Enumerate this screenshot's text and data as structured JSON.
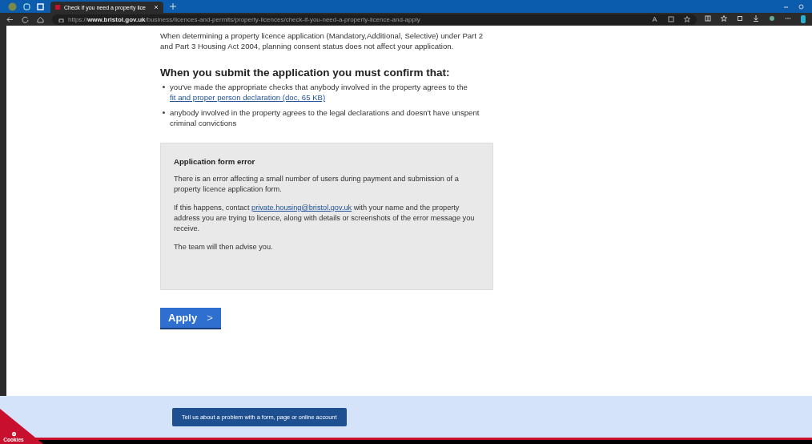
{
  "browser": {
    "tab": {
      "title": "Check if you need a property lice",
      "selected": true
    },
    "url": {
      "scheme": "https://",
      "domain": "www.bristol.gov.uk",
      "path": "/business/licences-and-permits/property-licences/check-if-you-need-a-property-licence-and-apply"
    }
  },
  "intro": "When determining a property licence application (Mandatory,Additional, Selective) under Part 2 and Part 3 Housing Act 2004, planning consent status does not affect your application.",
  "heading": "When you submit the application you must confirm that:",
  "bullets": [
    {
      "text": "you've made the appropriate checks that anybody involved in the property agrees to the ",
      "link": "fit and proper person declaration (doc, 65 KB)"
    },
    {
      "text": "anybody involved in the property agrees to the legal declarations and doesn't have unspent criminal convictions"
    }
  ],
  "notice": {
    "title": "Application form error",
    "paragraphs": [
      {
        "text": "There is an error affecting a small number of users during payment and submission of a property licence application form."
      },
      {
        "before": "If this happens, contact ",
        "link": "private.housing@bristol.gov.uk",
        "after": " with your name and the property address you are trying to licence, along with details or screenshots of the error message you receive."
      },
      {
        "text": "The team will then advise you."
      }
    ]
  },
  "apply_button": {
    "label": "Apply",
    "arrow": ">"
  },
  "footer": {
    "feedback_button": "Tell us about a problem with a form, page or online account"
  },
  "cookies": {
    "label": "Cookies"
  }
}
